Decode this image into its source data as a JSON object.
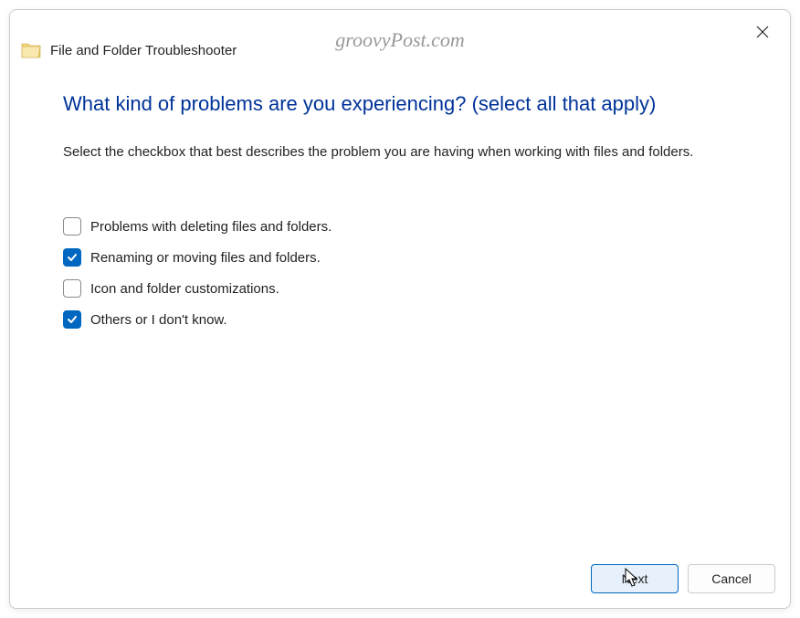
{
  "watermark": "groovyPost.com",
  "app_title": "File and Folder Troubleshooter",
  "heading": "What kind of problems are you experiencing? (select all that apply)",
  "description": "Select the checkbox that best describes the problem you are having when working with files and folders.",
  "options": [
    {
      "label": "Problems with deleting files and folders.",
      "checked": false
    },
    {
      "label": "Renaming or moving files and folders.",
      "checked": true
    },
    {
      "label": "Icon and folder customizations.",
      "checked": false
    },
    {
      "label": "Others or I don't know.",
      "checked": true
    }
  ],
  "buttons": {
    "next": "Next",
    "cancel": "Cancel"
  }
}
